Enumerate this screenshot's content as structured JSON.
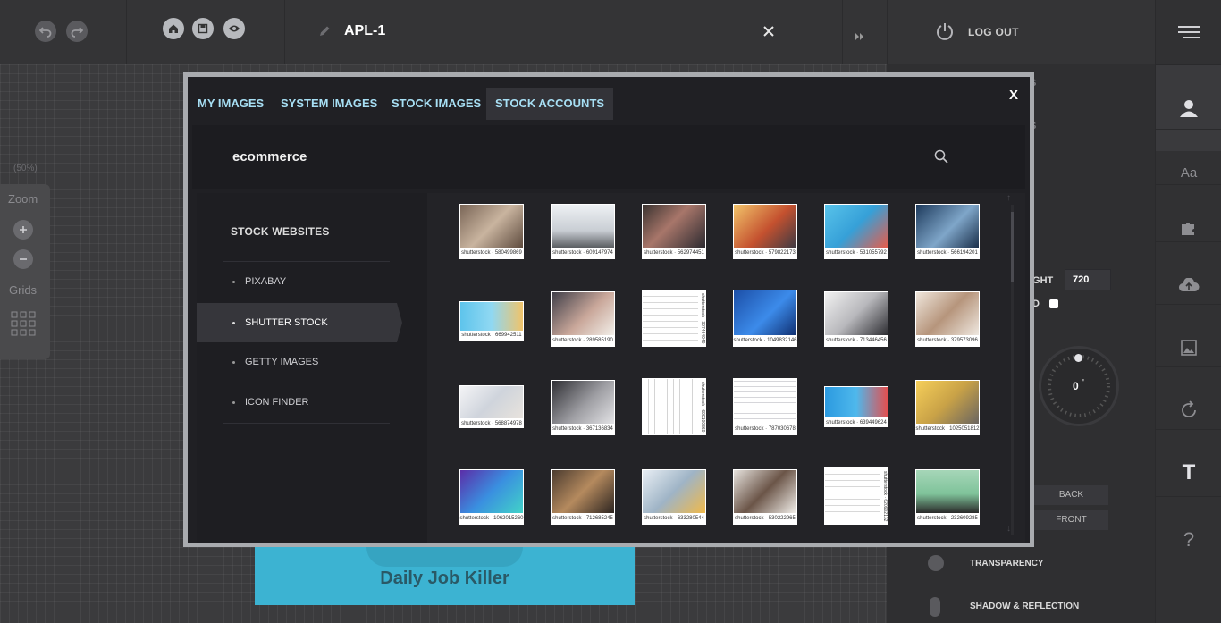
{
  "topbar": {
    "doc_title": "APL-1",
    "logout_label": "LOG OUT"
  },
  "left_panel": {
    "zoom_percent": "(50%)",
    "zoom_label": "Zoom",
    "grids_label": "Grids"
  },
  "canvas": {
    "banner_text": "Daily Job Killer"
  },
  "properties": {
    "row1_tail": "S",
    "row2_tail": "S",
    "height_label": "IGHT",
    "height_value": "720",
    "check_label": "D",
    "rotation_value": "0",
    "rotation_unit": "'",
    "back_label": "BACK",
    "front_label": "FRONT",
    "transparency_label": "TRANSPARENCY",
    "shadow_label": "SHADOW & REFLECTION"
  },
  "rightbar": {
    "text_tool": "Aa",
    "big_t": "T",
    "help": "?"
  },
  "modal": {
    "tabs": [
      "MY IMAGES",
      "SYSTEM IMAGES",
      "STOCK IMAGES",
      "STOCK ACCOUNTS"
    ],
    "active_tab": "STOCK ACCOUNTS",
    "close_label": "X",
    "search_value": "ecommerce",
    "nav_title": "STOCK WEBSITES",
    "nav_items": [
      "PIXABAY",
      "SHUTTER STOCK",
      "GETTY IMAGES",
      "ICON FINDER"
    ],
    "active_nav": "SHUTTER STOCK",
    "thumbs": [
      [
        "shutterstock · 580499869",
        "shutterstock · 609147974",
        "shutterstock · 562974451",
        "shutterstock · 579822173",
        "shutterstock · 531055792",
        "shutterstock · 566194201"
      ],
      [
        "shutterstock · 669942511",
        "shutterstock · 289585190",
        "shutterstock · 397464040",
        "shutterstock · 1049832146",
        "shutterstock · 713446456",
        "shutterstock · 379573096"
      ],
      [
        "shutterstock · 568874978",
        "shutterstock · 367136834",
        "shutterstock · 699100360",
        "shutterstock · 787030678",
        "shutterstock · 639449624",
        "shutterstock · 1025051812"
      ],
      [
        "shutterstock · 1062015260",
        "shutterstock · 712685245",
        "shutterstock · 633280544",
        "shutterstock · 530222965",
        "shutterstock · 620902132",
        "shutterstock · 232609285"
      ]
    ]
  }
}
